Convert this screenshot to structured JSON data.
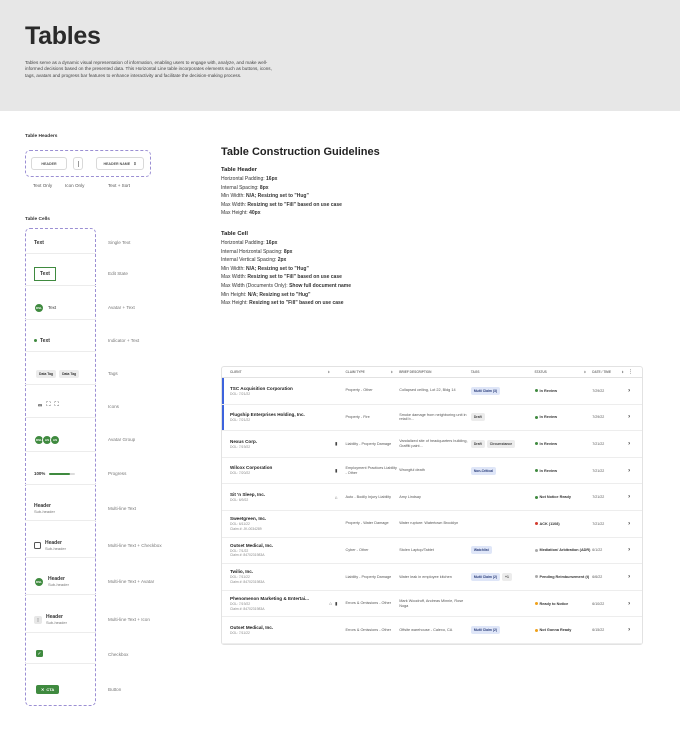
{
  "hero": {
    "title": "Tables",
    "description": "Tables serve as a dynamic visual representation of information, enabling users to engage with, analyze, and make well-informed decisions based on the presented data. This Horizontal Line table incorporates elements such as buttons, icons, tags, avatars and progress bar features to enhance interactivity and facilitate the decision-making process."
  },
  "headers_section": {
    "title": "Table Headers",
    "pill_header": "HEADER",
    "pill_sort": "HEADER NAME",
    "captions": [
      "Text Only",
      "Icon Only",
      "Text + Sort"
    ]
  },
  "cells_section": {
    "title": "Table Cells",
    "cells": [
      {
        "content": "Text",
        "label": "Single Text"
      },
      {
        "content": "Text",
        "label": "Edit State"
      },
      {
        "content": "Text",
        "avatar": "DSL",
        "label": "Avatar + Text"
      },
      {
        "content": "Text",
        "label": "Indicator + Text"
      },
      {
        "tags": [
          "Data Tag",
          "Data Tag"
        ],
        "label": "Tags"
      },
      {
        "label": "Icons"
      },
      {
        "avatars": [
          "DSL",
          "AS",
          "AS"
        ],
        "label": "Avatar Group"
      },
      {
        "content": "100%",
        "progress": 0.8,
        "label": "Progress"
      },
      {
        "content": "Header",
        "sub": "Sub-header",
        "label": "Multi-line Text"
      },
      {
        "content": "Header",
        "sub": "Sub-header",
        "label": "Multi-line Text + Checkbox"
      },
      {
        "content": "Header",
        "sub": "Sub-header",
        "avatar": "DSL",
        "label": "Multi-line Text + Avatar"
      },
      {
        "content": "Header",
        "sub": "Sub-header",
        "label": "Multi-line Text + Icon"
      },
      {
        "label": "Checkbox"
      },
      {
        "content": "CTA",
        "label": "Button"
      }
    ]
  },
  "guidelines": {
    "title": "Table Construction Guidelines",
    "header": {
      "title": "Table Header",
      "lines": [
        [
          "Horizontal Padding: ",
          "16px"
        ],
        [
          "Internal Spacing: ",
          "8px"
        ],
        [
          "Min Width: ",
          "N/A; Resizing set to \"Hug\""
        ],
        [
          "Max Width: ",
          "Resizing set to \"Fill\" based on use case"
        ],
        [
          "Max Height: ",
          "40px"
        ]
      ]
    },
    "cell": {
      "title": "Table Cell",
      "lines": [
        [
          "Horizontal Padding: ",
          "16px"
        ],
        [
          "Internal Horizontal Spacing: ",
          "8px"
        ],
        [
          "Internal Vertical Spacing: ",
          "2px"
        ],
        [
          "Min Width: ",
          "N/A; Resizing set to \"Hug\""
        ],
        [
          "Max Width: ",
          "Resizing set to \"Fill\" based on use case"
        ],
        [
          "Max Width (Documents Only): ",
          "Show full document name"
        ],
        [
          "Min Height: ",
          "N/A; Resizing set to \"Hug\""
        ],
        [
          "Max Height: ",
          "Resizing set to \"Fill\" based on use case"
        ]
      ]
    }
  },
  "table": {
    "columns": [
      "CLIENT",
      "CLAIM TYPE",
      "BRIEF DESCRIPTION",
      "TAGS",
      "STATUS",
      "DATE / TIME"
    ],
    "rows": [
      {
        "name": "TSC Acquisition Corporation",
        "sub": [
          "DOL: 7/21/22"
        ],
        "icons": [],
        "type": "Property - Other",
        "desc": "Collapsed ceiling, Lot 22, Bldg 14",
        "tags": [
          "Multi Claim (3)"
        ],
        "status": "In Review",
        "status_color": "#3f8a3f",
        "date": "7/29/22",
        "selected": true
      },
      {
        "name": "Plugship Enterprises Holding, Inc.",
        "sub": [
          "DOL: 7/21/22"
        ],
        "icons": [],
        "type": "Property - Fire",
        "desc": "Smoke damage from neighboring unit in retail b...",
        "tags": [
          "Draft"
        ],
        "status": "In Review",
        "status_color": "#3f8a3f",
        "date": "7/29/22",
        "selected": true
      },
      {
        "name": "Nexus Corp.",
        "sub": [
          "DOL: 7/19/22"
        ],
        "icons": [
          "▮"
        ],
        "type": "Liability - Property Damage",
        "desc": "Vandalized site of headquarters building, Graffiti paint...",
        "tags": [
          "Draft",
          "Circumstance"
        ],
        "status": "In Review",
        "status_color": "#3f8a3f",
        "date": "7/21/22",
        "selected": false
      },
      {
        "name": "Wilcox Corporation",
        "sub": [
          "DOL: 7/20/22"
        ],
        "icons": [
          "▮"
        ],
        "type": "Employment Practices Liability - Other",
        "desc": "Wrongful death",
        "tags": [
          "Non-Critical"
        ],
        "status": "In Review",
        "status_color": "#3f8a3f",
        "date": "7/21/22",
        "selected": false
      },
      {
        "name": "Sit 'n Sleep, Inc.",
        "sub": [
          "DOL: 6/9/22"
        ],
        "icons": [
          "⌂"
        ],
        "type": "Auto - Bodily Injury Liability",
        "desc": "Amy Lindsay",
        "tags": [],
        "status": "Not Notice Ready",
        "status_color": "#3f8a3f",
        "date": "7/21/22",
        "selected": false
      },
      {
        "name": "Sweetgreen, Inc.",
        "sub": [
          "DOL: 6/11/22",
          "Claim #: JK-0034289"
        ],
        "icons": [],
        "type": "Property - Water Damage",
        "desc": "Water rupture: Watertown Brooklyn",
        "tags": [],
        "status": "ACK (1108)",
        "status_color": "#d23b2e",
        "date": "7/21/22",
        "selected": false
      },
      {
        "name": "Outset Medical, Inc.",
        "sub": [
          "DOL: 7/1/22",
          "Claim #: 8470231983A"
        ],
        "icons": [],
        "type": "Cyber - Other",
        "desc": "Stolen Laptop/Tablet",
        "tags": [
          "Watchlist"
        ],
        "status": "Mediation/ Arbitration (ADR)",
        "status_color": "#aaaaaa",
        "date": "6/1/22",
        "selected": false
      },
      {
        "name": "Twilio, Inc.",
        "sub": [
          "DOL: 7/11/22",
          "Claim #: 8470231983A"
        ],
        "icons": [],
        "type": "Liability - Property Damage",
        "desc": "Water leak in employee kitchen",
        "tags": [
          "Multi Claim (2)",
          "+1"
        ],
        "status": "Pending Reimbursement (t)",
        "status_color": "#aaaaaa",
        "date": "6/6/22",
        "selected": false
      },
      {
        "name": "Phenomenon Marketing & Entertai...",
        "sub": [
          "DOL: 7/19/22",
          "Claim #: 8470231983A"
        ],
        "icons": [
          "⌂",
          "▮"
        ],
        "type": "Errors & Omissions - Other",
        "desc": "Mark Woodruff, Andreas Minnie, Rose Noga",
        "tags": [],
        "status": "Ready to Notice",
        "status_color": "#f0a11a",
        "date": "6/10/22",
        "selected": false
      },
      {
        "name": "Outset Medical, Inc.",
        "sub": [
          "DOL: 7/11/22"
        ],
        "icons": [],
        "type": "Errors & Omissions - Other",
        "desc": "Offsite warehouse - Calexo, CA",
        "tags": [
          "Multi Claim (2)"
        ],
        "status": "Not Gonna Ready",
        "status_color": "#f0a11a",
        "date": "6/15/22",
        "selected": false
      }
    ]
  }
}
